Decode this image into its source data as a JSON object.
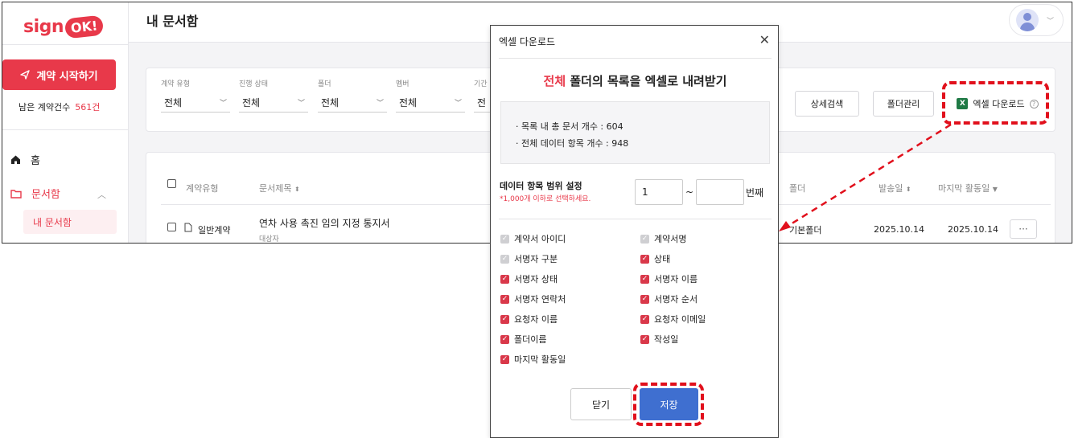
{
  "sidebar": {
    "logo_text": "sign",
    "logo_badge": "OK!",
    "start_button": "계약 시작하기",
    "remaining_label": "남은 계약건수",
    "remaining_count": "561건",
    "nav": [
      {
        "label": "홈",
        "icon": "home-icon"
      },
      {
        "label": "문서함",
        "icon": "folder-icon"
      }
    ],
    "subnav_active": "내 문서함"
  },
  "header": {
    "title": "내 문서함"
  },
  "filters": [
    {
      "label": "계약 유형",
      "value": "전체"
    },
    {
      "label": "진행 상태",
      "value": "전체"
    },
    {
      "label": "폴더",
      "value": "전체"
    },
    {
      "label": "멤버",
      "value": "전체"
    },
    {
      "label": "기간",
      "value": "전"
    }
  ],
  "toolbar": {
    "detail_search": "상세검색",
    "folder_manage": "폴더관리",
    "excel_download": "엑셀 다운로드"
  },
  "table": {
    "headers": {
      "type": "계약유형",
      "title": "문서제목",
      "folder": "폴더",
      "sent": "발송일",
      "last": "마지막 활동일"
    },
    "rows": [
      {
        "type": "일반계약",
        "title": "연차 사용 촉진 임의 지정 통지서",
        "sub": "대상자",
        "folder": "기본폴더",
        "sent": "2025.10.14",
        "last": "2025.10.14",
        "more": "···"
      }
    ]
  },
  "modal": {
    "title": "엑셀 다운로드",
    "close_icon": "✕",
    "heading_accent": "전체",
    "heading_rest": " 폴더의 목록을 엑셀로 내려받기",
    "info": [
      "· 목록 내 총 문서 개수 : 604",
      "· 전체 데이터 항목 개수 : 948"
    ],
    "range_label": "데이터 항목 범위 설정",
    "range_hint": "*1,000개 이하로 선택하세요.",
    "range_from": "1",
    "range_to": "",
    "range_tilde": "~",
    "range_unit": "번째",
    "fields": [
      {
        "label": "계약서 아이디",
        "state": "disabled"
      },
      {
        "label": "계약서명",
        "state": "disabled"
      },
      {
        "label": "서명자 구분",
        "state": "disabled"
      },
      {
        "label": "상태",
        "state": "checked"
      },
      {
        "label": "서명자 상태",
        "state": "checked"
      },
      {
        "label": "서명자 이름",
        "state": "checked"
      },
      {
        "label": "서명자 연락처",
        "state": "checked"
      },
      {
        "label": "서명자 순서",
        "state": "checked"
      },
      {
        "label": "요청자 이름",
        "state": "checked"
      },
      {
        "label": "요청자 이메일",
        "state": "checked"
      },
      {
        "label": "폴더이름",
        "state": "checked"
      },
      {
        "label": "작성일",
        "state": "checked"
      },
      {
        "label": "마지막 활동일",
        "state": "checked"
      }
    ],
    "close_button": "닫기",
    "save_button": "저장"
  },
  "colors": {
    "brand": "#e8394a",
    "primary": "#3f6fd0",
    "highlight": "#e1101c"
  }
}
